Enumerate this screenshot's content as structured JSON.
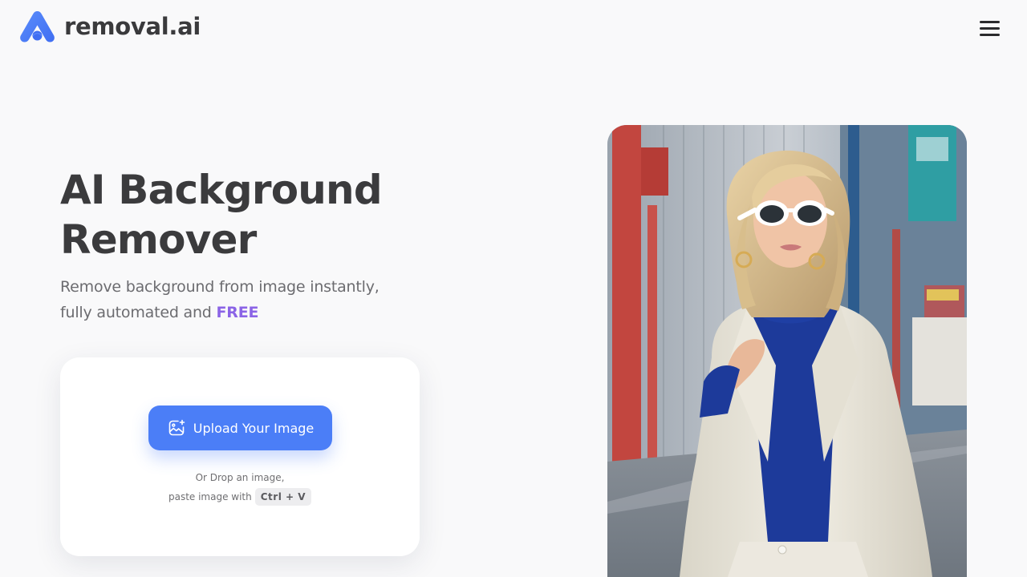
{
  "header": {
    "logo_text": "removal.ai",
    "logo_icon": "removal-ai-logo-mark",
    "menu_icon": "hamburger-menu-icon"
  },
  "hero": {
    "title_line1": "AI Background",
    "title_line2": "Remover",
    "subtitle_line1": "Remove background from image instantly,",
    "subtitle_line2_prefix": "fully automated and ",
    "subtitle_highlight": "FREE"
  },
  "upload": {
    "button_label": "Upload Your Image",
    "button_icon": "image-upload-icon",
    "drop_hint_line1": "Or Drop an image,",
    "drop_hint_line2": "paste image with",
    "shortcut": "Ctrl + V"
  },
  "hero_image": {
    "subject": "woman-in-white-blazer-and-sunglasses-photo"
  },
  "colors": {
    "background": "#f9f9fa",
    "brand_blue": "#4b7ef7",
    "free_purple": "#8b64e6",
    "title_text": "#3b3b3d",
    "subtitle_text": "#6c6c70"
  }
}
